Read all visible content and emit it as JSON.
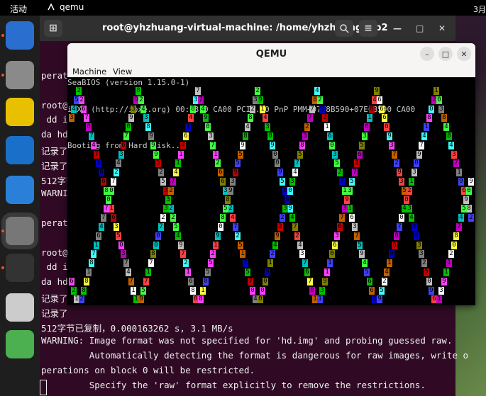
{
  "topbar": {
    "activities": "活动",
    "app_name": "qemu",
    "clock": "3月"
  },
  "dock": {
    "items": [
      {
        "name": "thunderbird-icon",
        "color": "#2a6fd0",
        "running": true
      },
      {
        "name": "files-icon",
        "color": "#8a8a8a",
        "running": true
      },
      {
        "name": "rhythmbox-icon",
        "color": "#e8c000",
        "running": false
      },
      {
        "name": "writer-icon",
        "color": "#1a6fc9",
        "running": false
      },
      {
        "name": "help-icon",
        "color": "#2a80d8",
        "running": false
      },
      {
        "name": "settings-icon",
        "color": "#777777",
        "running": true
      },
      {
        "name": "terminal-icon",
        "color": "#333333",
        "running": true
      },
      {
        "name": "dvd-icon",
        "color": "#cccccc",
        "running": false
      },
      {
        "name": "trash-icon",
        "color": "#4caf50",
        "running": false
      }
    ]
  },
  "terminal": {
    "title": "root@yhzhuang-virtual-machine: /home/yhzhuang/lab2",
    "lines": [
      "perati",
      "",
      "root@y",
      " dd if",
      "da hd.",
      "记录了",
      "记录了",
      "512字节",
      "WARNIN",
      "",
      "perati",
      "",
      "root@y",
      " dd if",
      "da hd.",
      "记录了",
      "记录了",
      "512字节已复制，0.000163262 s, 3.1 MB/s",
      "WARNING: Image format was not specified for 'hd.img' and probing guessed raw.",
      "         Automatically detecting the format is dangerous for raw images, write o",
      "perations on block 0 will be restricted.",
      "         Specify the 'raw' format explicitly to remove the restrictions."
    ]
  },
  "qemu": {
    "title": "QEMU",
    "menu": [
      "Machine",
      "View"
    ],
    "screen_lines": [
      "SeaBIOS (version 1.15.0-1)",
      "iPXE (http://ipxe.org) 00:03.0 CA00 PCI2.10 PnP PMM+07F8B590+07ECB590 CA00",
      "Booting from Hard Disk..."
    ],
    "digits": [
      "0",
      "1",
      "2",
      "3",
      "4",
      "5",
      "6",
      "7",
      "8",
      "9"
    ],
    "palette": [
      "#00c0c0",
      "#00c000",
      "#c000c0",
      "#c06000",
      "#c0c0c0",
      "#808080",
      "#4040ff",
      "#40ff40",
      "#40ffff",
      "#ff4040",
      "#ff40ff",
      "#ffff40",
      "#ffffff",
      "#0000c0",
      "#c00000",
      "#808000"
    ]
  }
}
